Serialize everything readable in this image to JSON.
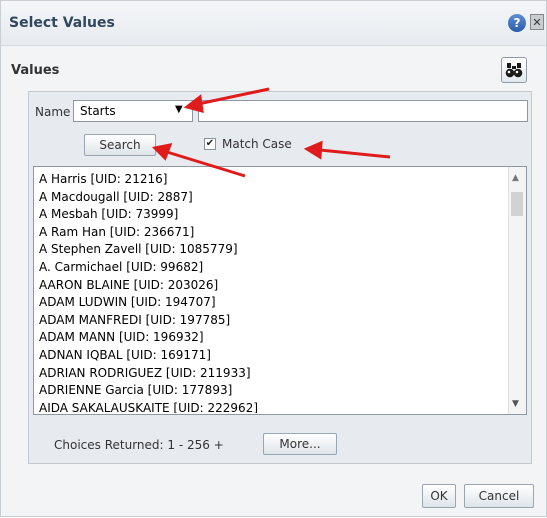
{
  "dialog": {
    "title": "Select Values",
    "help_icon": "help-icon",
    "close_icon": "close-icon"
  },
  "section": {
    "title": "Values",
    "binoculars_icon": "binoculars-icon"
  },
  "filter": {
    "name_label": "Name",
    "operator": "Starts",
    "search_value": "",
    "search_label": "Search",
    "match_case_label": "Match Case",
    "match_case_checked": true
  },
  "list": {
    "items": [
      "A Harris [UID: 21216]",
      "A Macdougall [UID: 2887]",
      "A Mesbah [UID: 73999]",
      "A Ram Han [UID: 236671]",
      "A Stephen Zavell [UID: 1085779]",
      "A. Carmichael [UID: 99682]",
      "AARON BLAINE [UID: 203026]",
      "ADAM LUDWIN [UID: 194707]",
      "ADAM MANFREDI [UID: 197785]",
      "ADAM MANN [UID: 196932]",
      "ADNAN IQBAL [UID: 169171]",
      "ADRIAN RODRIGUEZ [UID: 211933]",
      "ADRIENNE Garcia [UID: 177893]",
      "AIDA SAKALAUSKAITE [UID: 222962]"
    ]
  },
  "footer": {
    "choices_text": "Choices Returned: 1 - 256 +",
    "more_label": "More...",
    "ok_label": "OK",
    "cancel_label": "Cancel"
  },
  "colors": {
    "annotation_arrow": "#e01b1b",
    "title_text": "#30475f",
    "help_icon": "#2b5caa"
  }
}
